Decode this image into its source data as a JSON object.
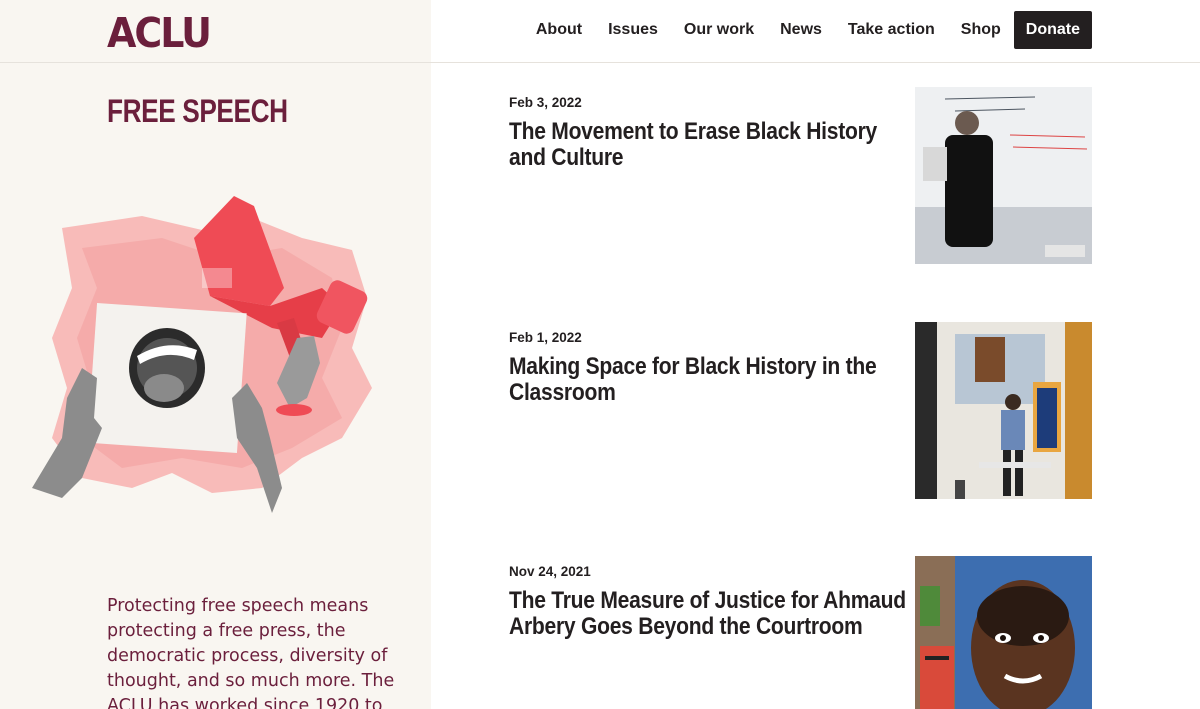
{
  "header": {
    "logo": "ACLU",
    "nav": [
      {
        "label": "About"
      },
      {
        "label": "Issues"
      },
      {
        "label": "Our work"
      },
      {
        "label": "News"
      },
      {
        "label": "Take action"
      },
      {
        "label": "Shop"
      }
    ],
    "donate_label": "Donate"
  },
  "sidebar": {
    "title": "FREE SPEECH",
    "description": "Protecting free speech means protecting a free press, the democratic process, diversity of thought, and so much more. The ACLU has worked since 1920 to"
  },
  "articles": [
    {
      "date": "Feb 3, 2022",
      "title": "The Movement to Erase Black History and Culture"
    },
    {
      "date": "Feb 1, 2022",
      "title": "Making Space for Black History in the Classroom"
    },
    {
      "date": "Nov 24, 2021",
      "title": "The True Measure of Justice for Ahmaud Arbery Goes Beyond the Courtroom"
    }
  ],
  "colors": {
    "brand": "#6b1f3c",
    "text": "#231f20",
    "panel_bg": "#f9f6f1",
    "accent_red": "#ef4b55"
  },
  "icons": [
    "megaphone-illustration",
    "mouth-illustration"
  ]
}
